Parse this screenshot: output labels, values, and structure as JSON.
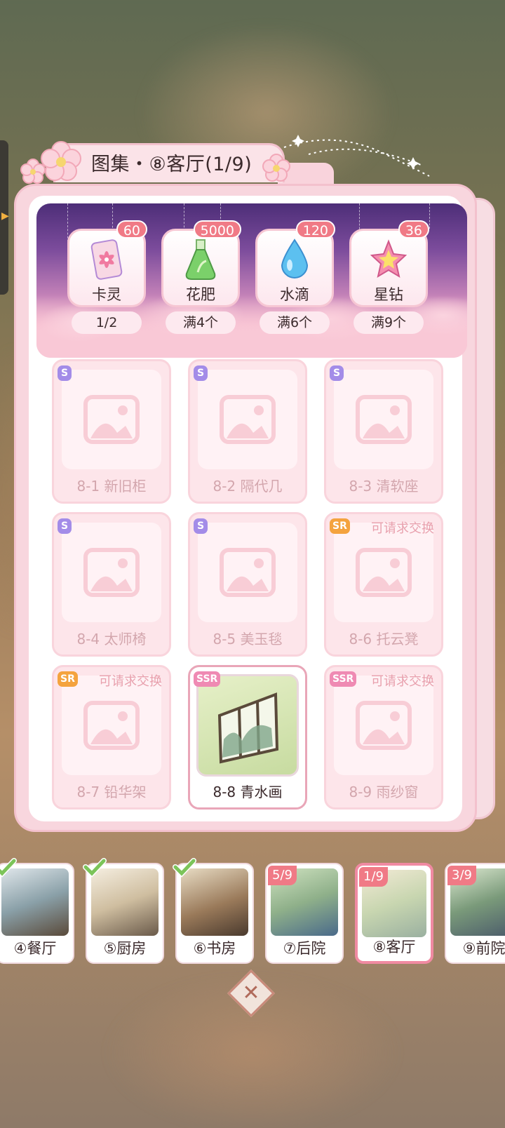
{
  "header": {
    "title": "图集・⑧客厅(1/9)"
  },
  "rewards": [
    {
      "name": "卡灵",
      "count": "60",
      "requirement": "1/2",
      "icon": "card-spirit-icon"
    },
    {
      "name": "花肥",
      "count": "5000",
      "requirement": "满4个",
      "icon": "fertilizer-flask-icon"
    },
    {
      "name": "水滴",
      "count": "120",
      "requirement": "满6个",
      "icon": "water-drop-icon"
    },
    {
      "name": "星钻",
      "count": "36",
      "requirement": "满9个",
      "icon": "star-diamond-icon"
    }
  ],
  "items": [
    {
      "label": "8-1 新旧柜",
      "rarity": "S",
      "tradable": "",
      "owned": false
    },
    {
      "label": "8-2 隔代几",
      "rarity": "S",
      "tradable": "",
      "owned": false
    },
    {
      "label": "8-3 清软座",
      "rarity": "S",
      "tradable": "",
      "owned": false
    },
    {
      "label": "8-4 太师椅",
      "rarity": "S",
      "tradable": "",
      "owned": false
    },
    {
      "label": "8-5 美玉毯",
      "rarity": "S",
      "tradable": "",
      "owned": false
    },
    {
      "label": "8-6 托云凳",
      "rarity": "SR",
      "tradable": "可请求交换",
      "owned": false
    },
    {
      "label": "8-7 铅华架",
      "rarity": "SR",
      "tradable": "可请求交换",
      "owned": false
    },
    {
      "label": "8-8 青水画",
      "rarity": "SSR",
      "tradable": "",
      "owned": true
    },
    {
      "label": "8-9 雨纱窗",
      "rarity": "SSR",
      "tradable": "可请求交换",
      "owned": false
    }
  ],
  "rooms": [
    {
      "label": "④餐厅",
      "progress": "",
      "complete": true,
      "active": false
    },
    {
      "label": "⑤厨房",
      "progress": "",
      "complete": true,
      "active": false
    },
    {
      "label": "⑥书房",
      "progress": "",
      "complete": true,
      "active": false
    },
    {
      "label": "⑦后院",
      "progress": "5/9",
      "complete": false,
      "active": false
    },
    {
      "label": "⑧客厅",
      "progress": "1/9",
      "complete": false,
      "active": true
    },
    {
      "label": "⑨前院",
      "progress": "3/9",
      "complete": false,
      "active": false
    }
  ],
  "colors": {
    "accent": "#f07a86",
    "panel": "#f8d6de",
    "banner_top": "#4d2e78",
    "rarity_s": "#a38ce8",
    "rarity_sr": "#f4a33e",
    "rarity_ssr": "#ef8ab3"
  },
  "close_icon": "close-icon"
}
